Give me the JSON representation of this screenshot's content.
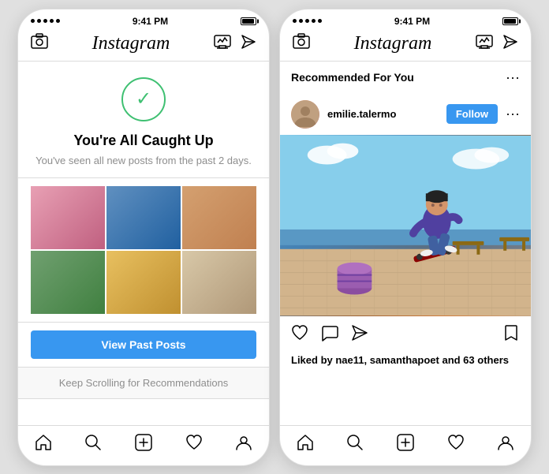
{
  "left_phone": {
    "status": {
      "dots": [
        1,
        2,
        3,
        4,
        5
      ],
      "time": "9:41 PM",
      "battery_full": true
    },
    "nav": {
      "logo": "Instagram",
      "camera_icon": "📷",
      "activity_icon": "📈",
      "send_icon": "✈"
    },
    "caught_up": {
      "title": "You're All Caught Up",
      "subtitle": "You've seen all new posts from the past 2 days."
    },
    "view_past_label": "View Past Posts",
    "keep_scrolling_label": "Keep Scrolling for Recommendations",
    "bottom_nav": {
      "home": "⌂",
      "search": "🔍",
      "add": "⊕",
      "heart": "♡",
      "profile": "👤"
    }
  },
  "right_phone": {
    "status": {
      "time": "9:41 PM"
    },
    "nav": {
      "logo": "Instagram"
    },
    "recommended_title": "Recommended For You",
    "username": "emilie.talermo",
    "follow_label": "Follow",
    "likes_text": "Liked by nae11, samanthapoet and 63 others",
    "bottom_nav": {
      "home": "⌂",
      "search": "🔍",
      "add": "⊕",
      "heart": "♡",
      "profile": "👤"
    }
  }
}
